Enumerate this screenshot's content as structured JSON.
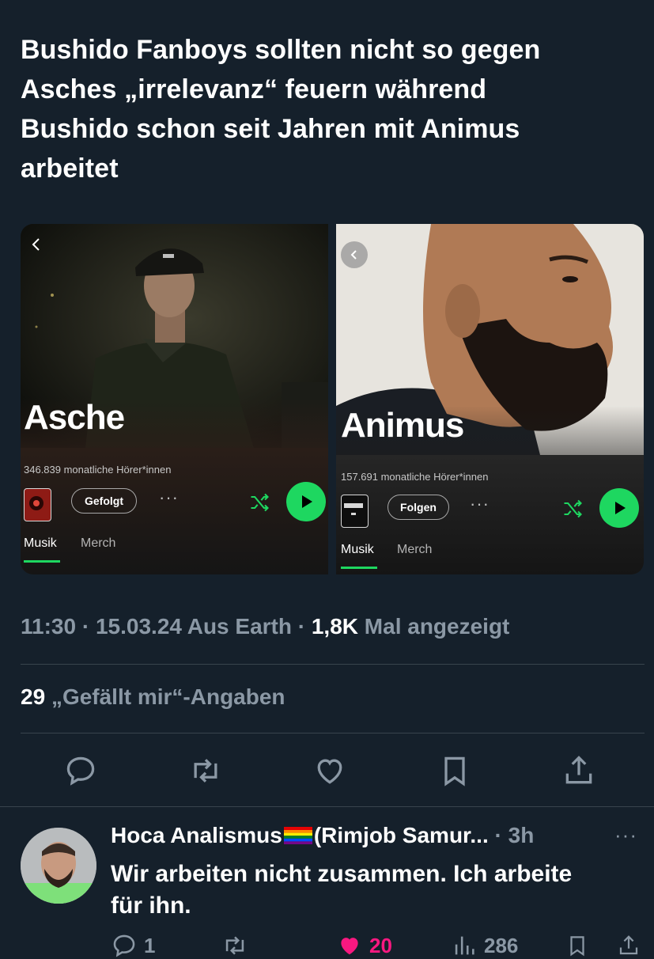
{
  "tweet": {
    "text_lines": [
      "Bushido Fanboys sollten nicht so gegen",
      "Asches „irrelevanz“ feuern während",
      "Bushido schon seit Jahren mit Animus",
      "arbeitet"
    ],
    "meta": {
      "time": "11:30",
      "date": "15.03.24",
      "location": "Aus Earth",
      "views_count": "1,8K",
      "views_label": "Mal angezeigt"
    },
    "likes": {
      "count": "29",
      "label": "„Gefällt mir“-Angaben"
    }
  },
  "spotify_left": {
    "artist": "Asche",
    "listeners": "346.839 monatliche Hörer*innen",
    "follow_label": "Gefolgt",
    "more": "···",
    "tabs": [
      "Musik",
      "Merch"
    ],
    "active_tab": "Musik"
  },
  "spotify_right": {
    "artist": "Animus",
    "listeners": "157.691 monatliche Hörer*innen",
    "follow_label": "Folgen",
    "more": "···",
    "tabs": [
      "Musik",
      "Merch"
    ],
    "active_tab": "Musik"
  },
  "reply": {
    "name": "Hoca Analismus",
    "name_suffix": "(Rimjob Samur...",
    "time": "· 3h",
    "more": "···",
    "text_lines": [
      "Wir arbeiten nicht zusammen. Ich arbeite",
      "für ihn."
    ],
    "actions": {
      "replies": "1",
      "likes": "20",
      "views": "286"
    }
  },
  "colors": {
    "background": "#15202b",
    "secondary_text": "#8b98a5",
    "spotify_green": "#1ed760",
    "like_pink": "#f91880"
  },
  "icons": [
    "reply-icon",
    "retweet-icon",
    "like-icon",
    "bookmark-icon",
    "share-icon",
    "shuffle-icon",
    "play-icon",
    "back-icon",
    "rainbow-flag-icon"
  ]
}
